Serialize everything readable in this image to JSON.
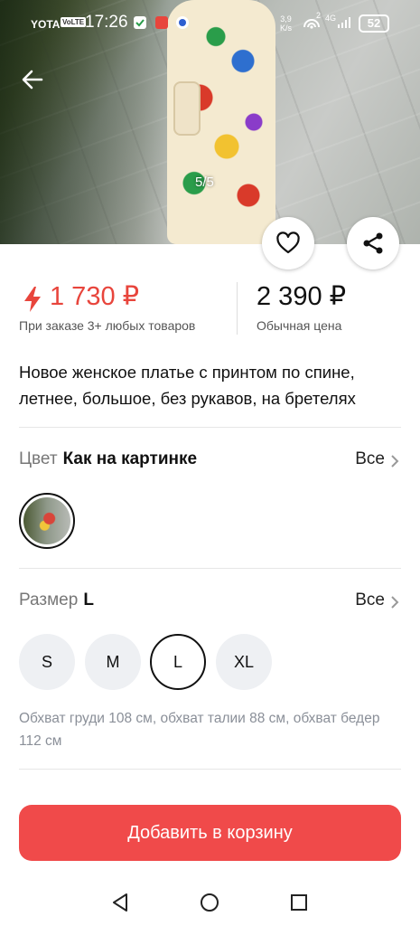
{
  "status_bar": {
    "carrier": "YOTA",
    "volte": "VoLTE",
    "time": "17:26",
    "speed_value": "3,9",
    "speed_unit": "K/s",
    "signal_extra": "2",
    "network": "4G",
    "battery": "52"
  },
  "gallery": {
    "counter": "5/5"
  },
  "pricing": {
    "bulk_price": "1 730 ₽",
    "bulk_note": "При заказе 3+ любых товаров",
    "regular_price": "2 390 ₽",
    "regular_note": "Обычная цена"
  },
  "product": {
    "title": "Новое женское платье с принтом по спине, летнее, большое, без рукавов, на бретелях"
  },
  "color_option": {
    "label": "Цвет",
    "value": "Как на картинке",
    "all_label": "Все"
  },
  "size_option": {
    "label": "Размер",
    "value": "L",
    "all_label": "Все",
    "sizes": [
      "S",
      "M",
      "L",
      "XL"
    ],
    "selected": "L",
    "description": "Обхват груди 108 см, обхват талии 88 см, обхват бедер 112 см"
  },
  "actions": {
    "add_to_cart": "Добавить в корзину"
  },
  "colors": {
    "accent": "#f04a4a",
    "price_accent": "#e8453c"
  },
  "icons": {
    "back": "arrow-left-icon",
    "favorite": "heart-icon",
    "share": "share-icon",
    "bolt": "lightning-icon",
    "chevron": "chevron-right-icon"
  }
}
